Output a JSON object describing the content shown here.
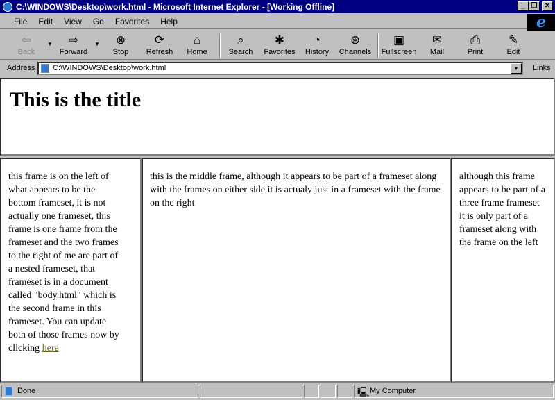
{
  "window": {
    "title": "C:\\WINDOWS\\Desktop\\work.html - Microsoft Internet Explorer - [Working Offline]",
    "min": "_",
    "max": "❐",
    "close": "✕"
  },
  "menu": [
    "File",
    "Edit",
    "View",
    "Go",
    "Favorites",
    "Help"
  ],
  "toolbar": [
    {
      "label": "Back",
      "icon": "⇦",
      "disabled": true
    },
    {
      "label": "Forward",
      "icon": "⇨"
    },
    {
      "label": "Stop",
      "icon": "⊗"
    },
    {
      "label": "Refresh",
      "icon": "⟳"
    },
    {
      "label": "Home",
      "icon": "⌂"
    },
    {
      "label": "Search",
      "icon": "⌕"
    },
    {
      "label": "Favorites",
      "icon": "✱"
    },
    {
      "label": "History",
      "icon": "◔"
    },
    {
      "label": "Channels",
      "icon": "⊛"
    },
    {
      "label": "Fullscreen",
      "icon": "▣"
    },
    {
      "label": "Mail",
      "icon": "✉"
    },
    {
      "label": "Print",
      "icon": "⎙"
    },
    {
      "label": "Edit",
      "icon": "✎"
    }
  ],
  "address": {
    "label": "Address",
    "value": "C:\\WINDOWS\\Desktop\\work.html",
    "links": "Links"
  },
  "frames": {
    "title": "This is the title",
    "left": "this frame is on the left of what appears to be the bottom frameset, it is not actually one frameset, this frame is one frame from the frameset and the two frames to the right of me are part of a nested frameset, that frameset is in a document called \"body.html\" which is the second frame in this frameset.  You can update both of those frames now by clicking ",
    "left_link": "here",
    "middle": "this is the middle frame, although it appears to be part of a frameset along with the frames on either side it is actualy just in a frameset with the frame on the right",
    "right": "although this frame appears to be part of a three frame frameset it is only part of a frameset along with the frame on the left"
  },
  "status": {
    "text": "Done",
    "zone": "My Computer"
  }
}
